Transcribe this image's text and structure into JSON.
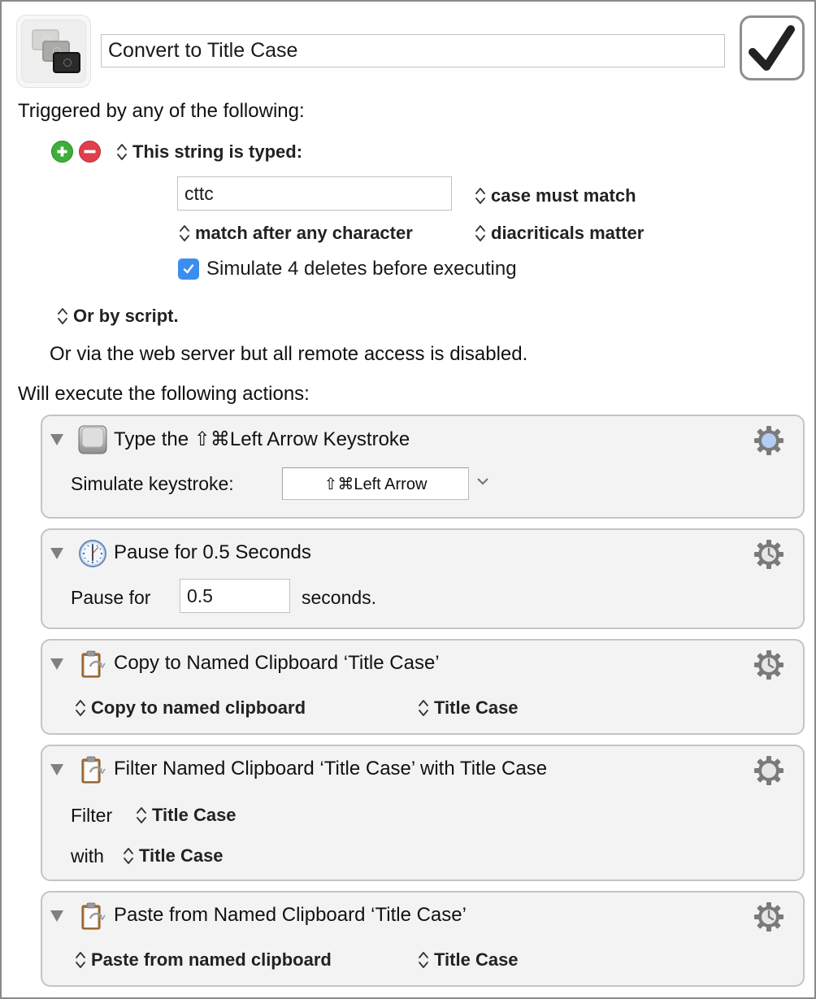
{
  "macro": {
    "name": "Convert to Title Case",
    "enabled": true,
    "icon": "screens-stack-icon"
  },
  "triggers": {
    "heading": "Triggered by any of the following:",
    "add_icon": "plus-circle-icon",
    "remove_icon": "minus-circle-icon",
    "trigger_type": "This string is typed:",
    "typed_string": "cttc",
    "case_option": "case must match",
    "match_option": "match after any character",
    "diacriticals_option": "diacriticals matter",
    "simulate_deletes": {
      "checked": true,
      "label": "Simulate 4 deletes before executing"
    },
    "script_option": "Or by script.",
    "web_server_note": "Or via the web server but all remote access is disabled."
  },
  "actions_heading": "Will execute the following actions:",
  "actions": [
    {
      "icon": "keycap-icon",
      "title": "Type the ⇧⌘Left Arrow Keystroke",
      "gear_icon": "gear-icon",
      "gear_state": "highlighted",
      "label": "Simulate keystroke:",
      "keystroke": "⇧⌘Left Arrow"
    },
    {
      "icon": "clock-icon",
      "title": "Pause for 0.5 Seconds",
      "gear_icon": "gear-clock-icon",
      "label": "Pause for",
      "value": "0.5",
      "suffix": "seconds."
    },
    {
      "icon": "clipboard-icon",
      "title": "Copy to Named Clipboard ‘Title Case’",
      "gear_icon": "gear-clock-icon",
      "operation": "Copy to named clipboard",
      "clipboard": "Title Case"
    },
    {
      "icon": "clipboard-icon",
      "title": "Filter Named Clipboard ‘Title Case’ with Title Case",
      "gear_icon": "gear-icon",
      "filter_label": "Filter",
      "filter_clipboard": "Title Case",
      "with_label": "with",
      "with_filter": "Title Case"
    },
    {
      "icon": "clipboard-icon",
      "title": "Paste from Named Clipboard ‘Title Case’",
      "gear_icon": "gear-clock-icon",
      "operation": "Paste from named clipboard",
      "clipboard": "Title Case"
    }
  ],
  "colors": {
    "add": "#3fae3a",
    "remove": "#e0404b",
    "checkbox": "#3b8ef0",
    "card_bg": "#f3f3f3",
    "gear": "#7a7a7a",
    "gear_highlight": "#b5cdf5"
  }
}
